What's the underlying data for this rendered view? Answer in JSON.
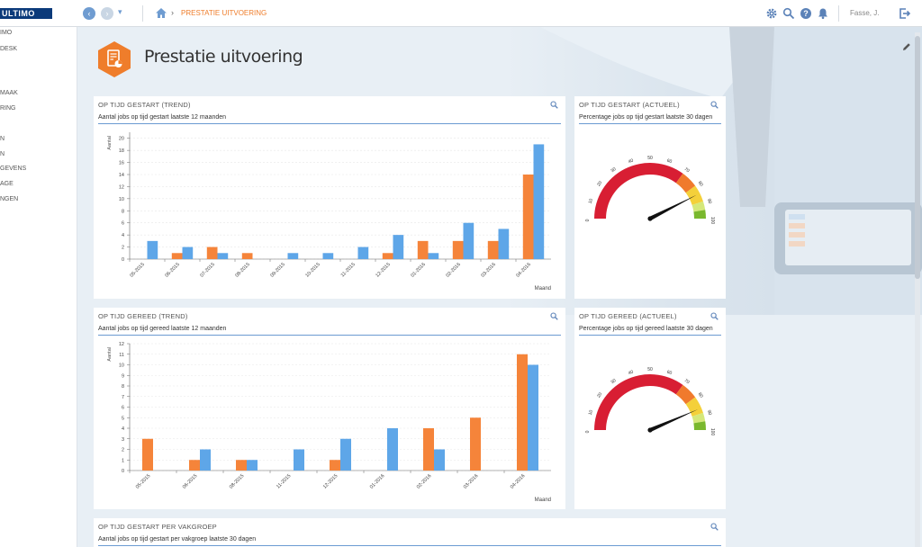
{
  "header": {
    "logo": "ULTIMO",
    "breadcrumb": "PRESTATIE UITVOERING",
    "user": "Fasse, J."
  },
  "sidebar": {
    "items": [
      "IMO",
      "DESK",
      "MAAK",
      "RING",
      "N",
      "N",
      "GEVENS",
      "AGE",
      "NGEN"
    ]
  },
  "page": {
    "title": "Prestatie uitvoering"
  },
  "panels": {
    "p1": {
      "title": "OP TIJD GESTART (TREND)",
      "subtitle": "Aantal jobs op tijd gestart laatste 12 maanden"
    },
    "p2": {
      "title": "OP TIJD GESTART (ACTUEEL)",
      "subtitle": "Percentage jobs op tijd gestart laatste 30 dagen"
    },
    "p3": {
      "title": "OP TIJD GEREED (TREND)",
      "subtitle": "Aantal jobs op tijd gereed laatste 12 maanden"
    },
    "p4": {
      "title": "OP TIJD GEREED (ACTUEEL)",
      "subtitle": "Percentage jobs op tijd gereed laatste 30 dagen"
    },
    "p5": {
      "title": "OP TIJD GESTART PER VAKGROEP",
      "subtitle": "Aantal jobs op tijd gestart per vakgroep laatste 30 dagen"
    }
  },
  "colors": {
    "orange": "#f5843a",
    "blue": "#5ea6e8",
    "accent": "#ef7d2b",
    "navy": "#0b3a7a"
  },
  "chart_data": [
    {
      "type": "bar",
      "title": "",
      "xlabel": "Maand",
      "ylabel": "Aantal",
      "ylim": [
        0,
        21
      ],
      "yticks": [
        0,
        2,
        4,
        6,
        8,
        10,
        12,
        14,
        16,
        18,
        20
      ],
      "categories": [
        "05-2015",
        "06-2015",
        "07-2015",
        "08-2015",
        "09-2015",
        "10-2015",
        "11-2015",
        "12-2015",
        "01-2016",
        "02-2016",
        "03-2016",
        "04-2016"
      ],
      "series": [
        {
          "values": [
            0,
            1,
            2,
            1,
            0,
            0,
            0,
            1,
            3,
            3,
            3,
            14
          ]
        },
        {
          "values": [
            3,
            2,
            1,
            0,
            1,
            1,
            2,
            4,
            1,
            6,
            5,
            19
          ]
        }
      ]
    },
    {
      "type": "bar",
      "title": "",
      "xlabel": "Maand",
      "ylabel": "Aantal",
      "ylim": [
        0,
        12
      ],
      "yticks": [
        0,
        1,
        2,
        3,
        4,
        5,
        6,
        7,
        8,
        9,
        10,
        11,
        12
      ],
      "categories": [
        "05-2015",
        "06-2015",
        "08-2015",
        "11-2015",
        "12-2015",
        "01-2016",
        "02-2016",
        "03-2016",
        "04-2016"
      ],
      "series": [
        {
          "values": [
            3,
            1,
            1,
            0,
            1,
            0,
            4,
            5,
            11
          ]
        },
        {
          "values": [
            0,
            2,
            1,
            2,
            3,
            4,
            2,
            0,
            10
          ]
        }
      ]
    }
  ],
  "gauges": [
    {
      "value": 85,
      "ticks": [
        "0",
        "10",
        "20",
        "30",
        "40",
        "50",
        "60",
        "70",
        "80",
        "90",
        "100"
      ]
    },
    {
      "value": 87,
      "ticks": [
        "0",
        "10",
        "20",
        "30",
        "40",
        "50",
        "60",
        "70",
        "80",
        "90",
        "100"
      ]
    }
  ]
}
